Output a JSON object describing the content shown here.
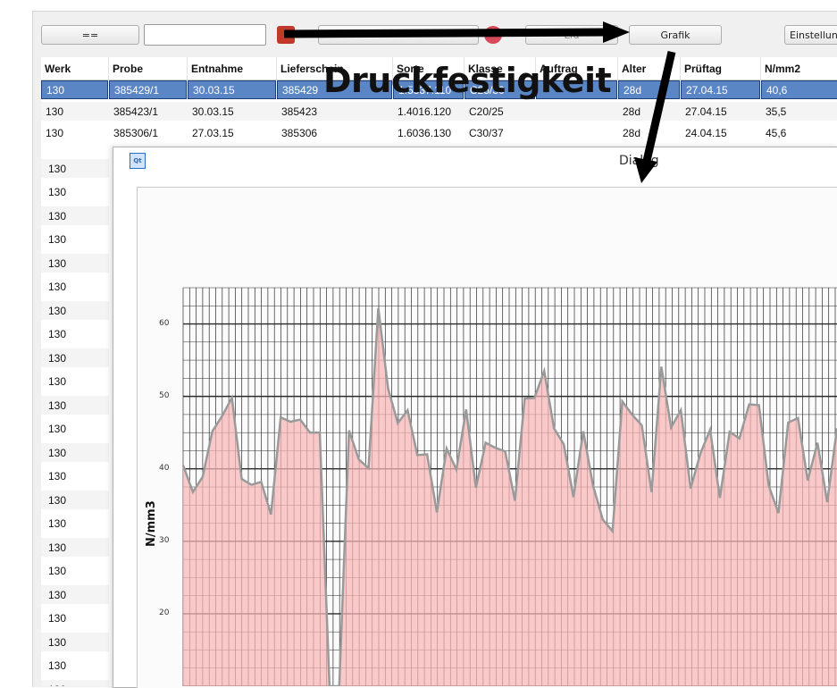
{
  "toolbar": {
    "eq_label": "==",
    "search_value": "",
    "hidden_label": "Lfd",
    "grafik_label": "Grafik",
    "einstellungen_label": "Einstellun"
  },
  "table": {
    "columns": [
      "Werk",
      "Probe",
      "Entnahme",
      "Lieferschein",
      "Sorte",
      "Klasse",
      "Auftrag",
      "Alter",
      "Prüftag",
      "N/mm2"
    ],
    "rows": [
      {
        "Werk": "130",
        "Probe": "385429/1",
        "Entnahme": "30.03.15",
        "Lieferschein": "385429",
        "Sorte": "1.5337.110",
        "Klasse": "C25/30",
        "Auftrag": "",
        "Alter": "28d",
        "Prueftag": "27.04.15",
        "Nmm2": "40,6",
        "selected": true
      },
      {
        "Werk": "130",
        "Probe": "385423/1",
        "Entnahme": "30.03.15",
        "Lieferschein": "385423",
        "Sorte": "1.4016.120",
        "Klasse": "C20/25",
        "Auftrag": "",
        "Alter": "28d",
        "Prueftag": "27.04.15",
        "Nmm2": "35,5",
        "selected": false
      },
      {
        "Werk": "130",
        "Probe": "385306/1",
        "Entnahme": "27.03.15",
        "Lieferschein": "385306",
        "Sorte": "1.6036.130",
        "Klasse": "C30/37",
        "Auftrag": "",
        "Alter": "28d",
        "Prueftag": "24.04.15",
        "Nmm2": "45,6",
        "selected": false
      }
    ],
    "werk_rest": [
      "130",
      "130",
      "130",
      "130",
      "130",
      "130",
      "130",
      "130",
      "130",
      "130",
      "130",
      "130",
      "130",
      "130",
      "130",
      "130",
      "130",
      "130",
      "130",
      "130",
      "130",
      "130",
      "130"
    ]
  },
  "dialog": {
    "title": "Dialog",
    "icon_label": "Qt"
  },
  "chart_data": {
    "type": "area",
    "title": "Druckfestigkeit",
    "xlabel": "",
    "ylabel": "N/mm3",
    "y_ticks": [
      "60",
      "50",
      "40",
      "30",
      "20"
    ],
    "ylim": [
      10,
      65
    ],
    "grid": true,
    "fill_color": "#f8b4b4",
    "line_color": "#9a9a9a",
    "values": [
      40.5,
      36.8,
      38.9,
      45.2,
      47.3,
      49.8,
      38.6,
      37.8,
      38.2,
      33.7,
      47.1,
      46.5,
      46.8,
      45.0,
      45.0,
      0,
      0,
      45.3,
      41.3,
      40.1,
      62.2,
      51.1,
      46.3,
      48.1,
      41.9,
      42.0,
      34.0,
      42.8,
      39.9,
      48.2,
      37.4,
      43.6,
      42.9,
      42.4,
      35.6,
      49.7,
      49.8,
      53.5,
      45.6,
      43.4,
      36.1,
      45.2,
      37.7,
      33.0,
      31.4,
      49.3,
      47.5,
      46.0,
      36.8,
      54.1,
      45.7,
      48.1,
      37.3,
      42.1,
      45.4,
      36.0,
      45.1,
      44.2,
      48.9,
      48.8,
      37.7,
      33.9,
      46.4,
      47.0,
      38.4,
      43.6,
      35.4,
      45.6
    ]
  },
  "colors": {
    "selection": "#5b86c6",
    "arrow": "#000000"
  }
}
